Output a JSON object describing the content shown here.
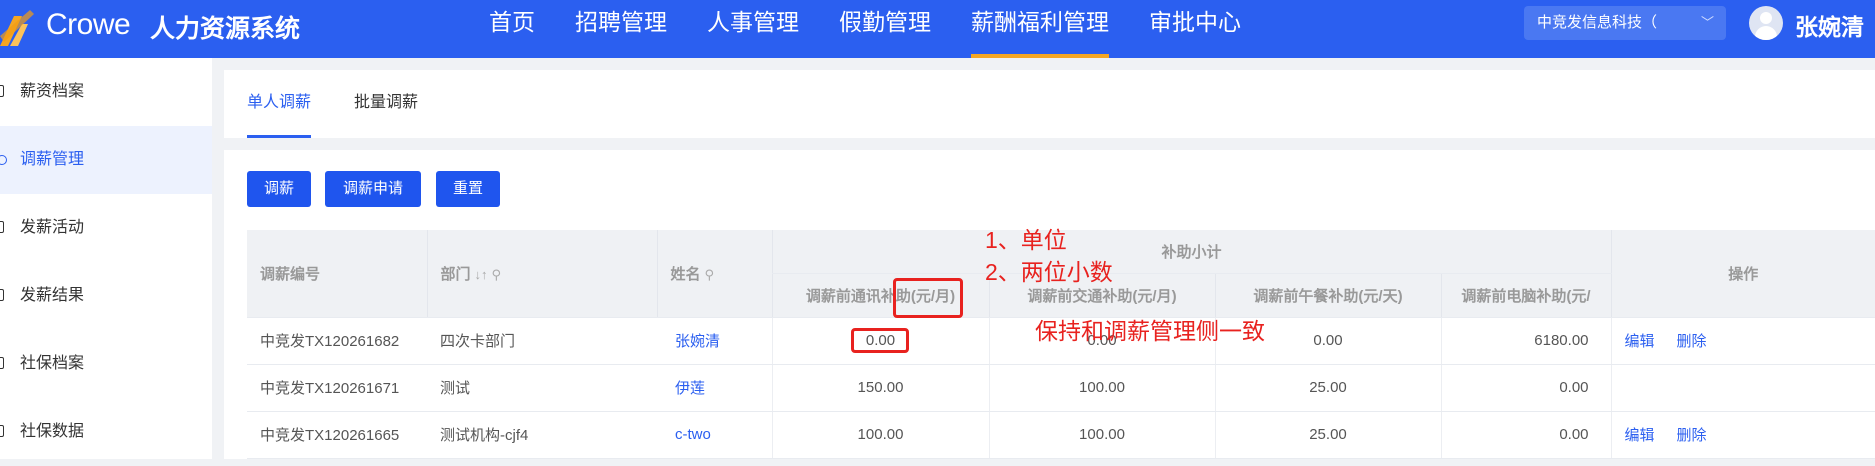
{
  "header": {
    "brand_logo": "Crowe",
    "system_title": "人力资源系统",
    "nav": [
      {
        "label": "首页",
        "active": false
      },
      {
        "label": "招聘管理",
        "active": false
      },
      {
        "label": "人事管理",
        "active": false
      },
      {
        "label": "假勤管理",
        "active": false
      },
      {
        "label": "薪酬福利管理",
        "active": true
      },
      {
        "label": "审批中心",
        "active": false
      }
    ],
    "company_select": "中竞发信息科技（",
    "username": "张婉清",
    "bar_color": "#2b5ff0",
    "active_underline_color": "#f5a623"
  },
  "sidebar": {
    "items": [
      {
        "label": "薪资档案",
        "active": false
      },
      {
        "label": "调薪管理",
        "active": true
      },
      {
        "label": "发薪活动",
        "active": false
      },
      {
        "label": "发薪结果",
        "active": false
      },
      {
        "label": "社保档案",
        "active": false
      },
      {
        "label": "社保数据",
        "active": false
      }
    ]
  },
  "tabs": [
    {
      "label": "单人调薪",
      "active": true
    },
    {
      "label": "批量调薪",
      "active": false
    }
  ],
  "toolbar": {
    "adjust_label": "调薪",
    "apply_label": "调薪申请",
    "reset_label": "重置"
  },
  "table": {
    "headers": {
      "id": "调薪编号",
      "dept": "部门",
      "name": "姓名",
      "group": "补助小计",
      "comm": "调薪前通讯补助(元/月)",
      "traffic": "调薪前交通补助(元/月)",
      "lunch": "调薪前午餐补助(元/天)",
      "pc": "调薪前电脑补助(元/",
      "ops": "操作"
    },
    "rows": [
      {
        "id": "中竞发TX120261682",
        "dept": "四次卡部门",
        "name": "张婉清",
        "comm": "0.00",
        "traffic": "0.00",
        "lunch": "0.00",
        "pc": "6180.00",
        "edit": "编辑",
        "delete": "删除"
      },
      {
        "id": "中竞发TX120261671",
        "dept": "测试",
        "name": "伊莲",
        "comm": "150.00",
        "traffic": "100.00",
        "lunch": "25.00",
        "pc": "0.00",
        "edit": "",
        "delete": ""
      },
      {
        "id": "中竞发TX120261665",
        "dept": "测试机构-cjf4",
        "name": "c-two",
        "comm": "100.00",
        "traffic": "100.00",
        "lunch": "25.00",
        "pc": "0.00",
        "edit": "编辑",
        "delete": "删除"
      }
    ]
  },
  "annotations": {
    "note1": "1、单位",
    "note2": "2、两位小数",
    "note3": "保持和调薪管理侧一致",
    "color": "#e8221f"
  }
}
